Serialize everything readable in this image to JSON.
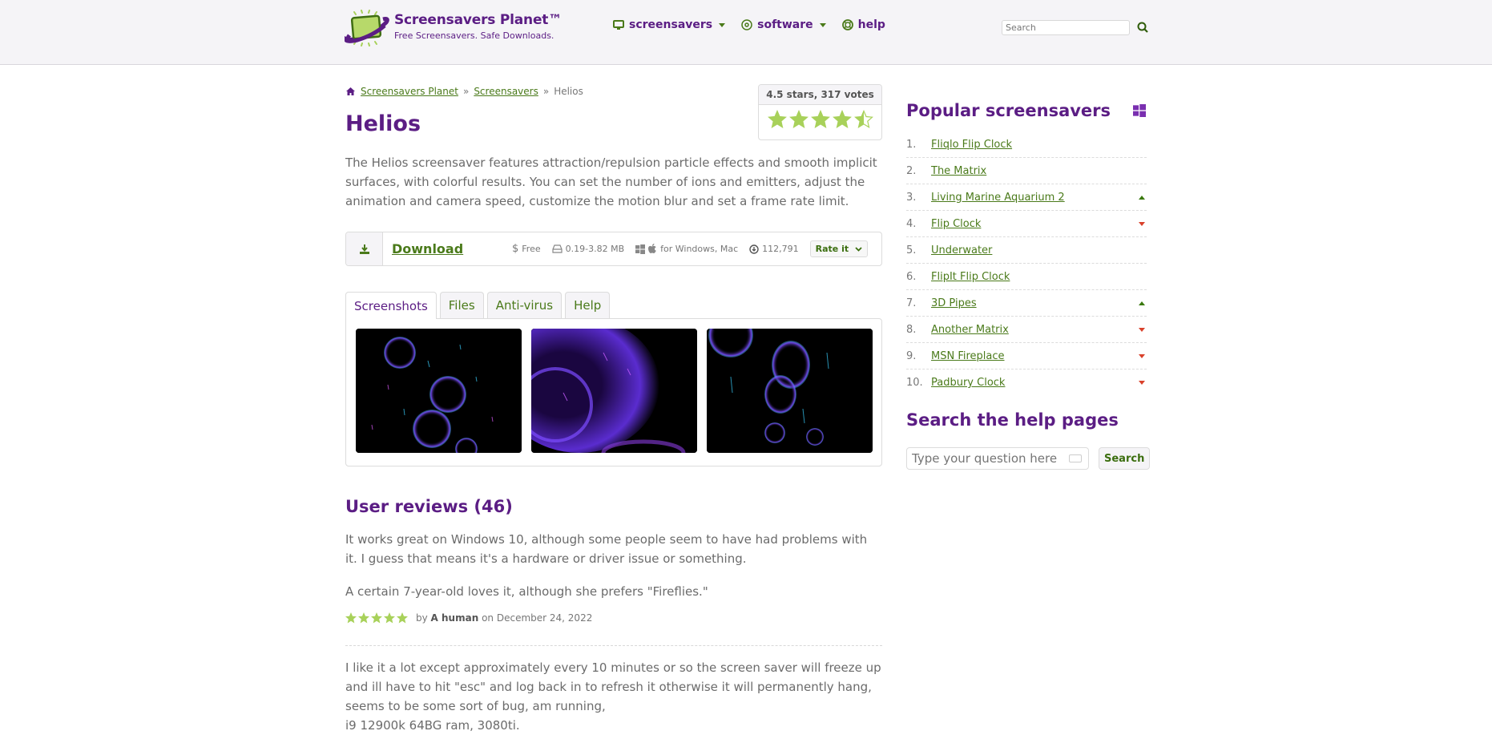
{
  "header": {
    "brand_title": "Screensavers Planet™",
    "brand_tagline": "Free Screensavers. Safe Downloads.",
    "nav": [
      {
        "label": "screensavers",
        "icon": "monitor-icon",
        "dropdown": true
      },
      {
        "label": "software",
        "icon": "disc-icon",
        "dropdown": true
      },
      {
        "label": "help",
        "icon": "lifebuoy-icon",
        "dropdown": false
      }
    ],
    "search_placeholder": "Search"
  },
  "breadcrumb": [
    {
      "label": "Screensavers Planet",
      "link": true
    },
    {
      "label": "Screensavers",
      "link": true
    },
    {
      "label": "Helios",
      "link": false
    }
  ],
  "breadcrumb_sep": "»",
  "title": "Helios",
  "rating": {
    "text": "4.5 stars, 317 votes",
    "value": 4.5,
    "max": 5,
    "votes": 317
  },
  "description": "The Helios screensaver features attraction/repulsion particle effects and smooth implicit surfaces, with colorful results. You can set the number of ions and emitters, adjust the animation and camera speed, customize the motion blur and set a frame rate limit.",
  "download": {
    "label": "Download",
    "price": "Free",
    "size": "0.19-3.82 MB",
    "platforms": "for Windows, Mac",
    "downloads": "112,791",
    "rate_label": "Rate it"
  },
  "tabs": [
    "Screenshots",
    "Files",
    "Anti-virus",
    "Help"
  ],
  "active_tab": 0,
  "screenshots": [
    "Helios screenshot 1",
    "Helios screenshot 2",
    "Helios screenshot 3"
  ],
  "reviews": {
    "title": "User reviews (46)",
    "items": [
      {
        "paragraphs": [
          "It works great on Windows 10, although some people seem to have had problems with it. I guess that means it's a hardware or driver issue or something.",
          "A certain 7-year-old loves it, although she prefers \"Fireflies.\""
        ],
        "stars": 5,
        "by_prefix": "by",
        "author": "A human",
        "date_prefix": "on",
        "date": "December 24, 2022"
      },
      {
        "paragraphs": [
          "I like it a lot except approximately every 10 minutes or so the screen saver will freeze up and ill have to hit \"esc\" and log back in to refresh it otherwise it will permanently hang, seems to be some sort of bug, am running,\ni9 12900k 64BG ram, 3080ti."
        ]
      }
    ]
  },
  "sidebar": {
    "popular_title": "Popular screensavers",
    "popular": [
      {
        "rank": "1.",
        "name": "Fliqlo Flip Clock",
        "trend": ""
      },
      {
        "rank": "2.",
        "name": "The Matrix",
        "trend": ""
      },
      {
        "rank": "3.",
        "name": "Living Marine Aquarium 2",
        "trend": "up"
      },
      {
        "rank": "4.",
        "name": "Flip Clock",
        "trend": "down"
      },
      {
        "rank": "5.",
        "name": "Underwater",
        "trend": ""
      },
      {
        "rank": "6.",
        "name": "FlipIt Flip Clock",
        "trend": ""
      },
      {
        "rank": "7.",
        "name": "3D Pipes",
        "trend": "up"
      },
      {
        "rank": "8.",
        "name": "Another Matrix",
        "trend": "down"
      },
      {
        "rank": "9.",
        "name": "MSN Fireplace",
        "trend": "down"
      },
      {
        "rank": "10.",
        "name": "Padbury Clock",
        "trend": "down"
      }
    ],
    "help_title": "Search the help pages",
    "help_placeholder": "Type your question here",
    "help_button": "Search"
  },
  "colors": {
    "brand_purple": "#5b1d84",
    "link_green": "#4a7a1a",
    "star_green": "#a8d15a",
    "trend_up": "#3b7a10",
    "trend_down": "#d9412b"
  }
}
